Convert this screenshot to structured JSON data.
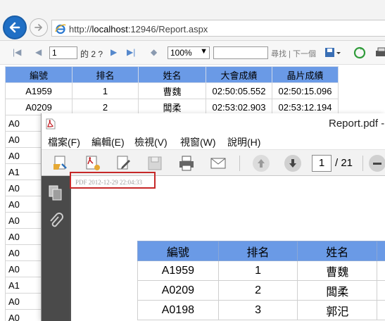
{
  "browser": {
    "url_prefix": "http://",
    "url_host": "localhost",
    "url_rest": ":12946/Report.aspx"
  },
  "report_toolbar": {
    "page_value": "1",
    "page_of": "的 2 ?",
    "zoom_value": "100%",
    "find_value": "",
    "find_label": "尋找 | 下一個"
  },
  "web_table": {
    "headers": [
      "編號",
      "排名",
      "姓名",
      "大會成績",
      "晶片成績"
    ],
    "rows": [
      [
        "A1959",
        "1",
        "曹魏",
        "02:50:05.552",
        "02:50:15.096"
      ],
      [
        "A0209",
        "2",
        "闆柔",
        "02:53:02.903",
        "02:53:12.194"
      ],
      [
        "A0",
        "",
        "",
        "",
        ""
      ],
      [
        "A0",
        "",
        "",
        "",
        ""
      ],
      [
        "A0",
        "",
        "",
        "",
        ""
      ],
      [
        "A1",
        "",
        "",
        "",
        ""
      ],
      [
        "A0",
        "",
        "",
        "",
        ""
      ],
      [
        "A0",
        "",
        "",
        "",
        ""
      ],
      [
        "A0",
        "",
        "",
        "",
        ""
      ],
      [
        "A0",
        "",
        "",
        "",
        ""
      ],
      [
        "A0",
        "",
        "",
        "",
        ""
      ],
      [
        "A0",
        "",
        "",
        "",
        ""
      ],
      [
        "A1",
        "",
        "",
        "",
        ""
      ],
      [
        "A0",
        "",
        "",
        "",
        ""
      ],
      [
        "A0",
        "",
        "",
        "",
        ""
      ]
    ]
  },
  "reader": {
    "title": "Report.pdf -",
    "menu": [
      "檔案(F)",
      "編輯(E)",
      "檢視(V)",
      "視窗(W)",
      "說明(H)"
    ],
    "page_value": "1",
    "page_total": "/ 21",
    "stamp": "PDF 2012-12-29 22:04:33",
    "table": {
      "headers": [
        "編號",
        "排名",
        "姓名",
        ""
      ],
      "rows": [
        [
          "A1959",
          "1",
          "曹魏",
          ""
        ],
        [
          "A0209",
          "2",
          "闆柔",
          ""
        ],
        [
          "A0198",
          "3",
          "郭汜",
          ""
        ]
      ]
    }
  },
  "colors": {
    "header_blue": "#6a9ae6",
    "back_button": "#1f6fc5",
    "highlight_red": "#c62828",
    "reader_pane": "#4a4a4a"
  }
}
